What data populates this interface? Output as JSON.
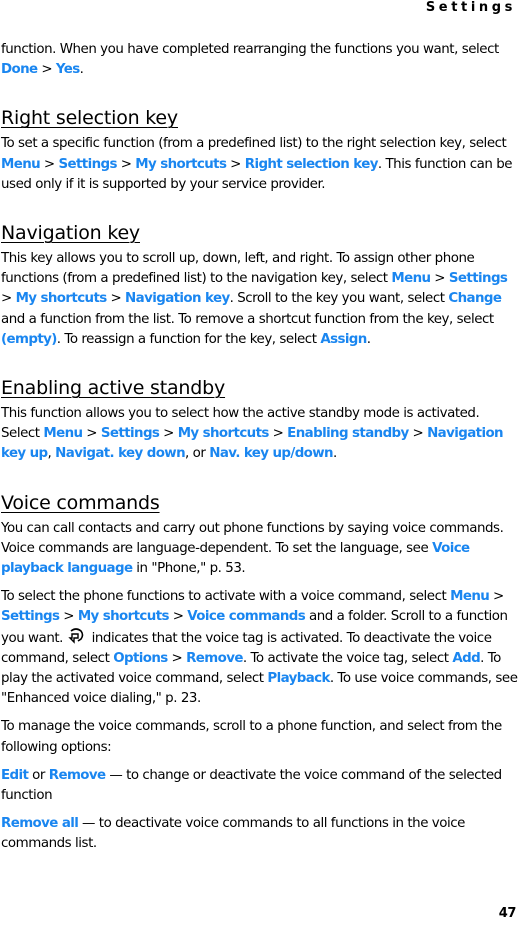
{
  "header": {
    "section": "Settings"
  },
  "footer": {
    "page_number": "47"
  },
  "intro": {
    "text1": "function. When you have completed rearranging the functions you want, select ",
    "link1": "Done",
    "sep1": " > ",
    "link2": "Yes",
    "text2": "."
  },
  "right_selection_key": {
    "title": "Right selection key",
    "t1": "To set a specific function (from a predefined list) to the right selection key, select ",
    "l1": "Menu",
    "s1": " > ",
    "l2": "Settings",
    "s2": " > ",
    "l3": "My shortcuts",
    "s3": " > ",
    "l4": "Right selection key",
    "t2": ". This function can be used only if it is supported by your service provider."
  },
  "navigation_key": {
    "title": "Navigation key",
    "t1": "This key allows you to scroll up, down, left, and right. To assign other phone functions (from a predefined list) to the navigation key, select ",
    "l1": "Menu",
    "s1": " > ",
    "l2": "Settings",
    "s2": " > ",
    "l3": "My shortcuts",
    "s3": " > ",
    "l4": "Navigation key",
    "t2": ". Scroll to the key you want, select ",
    "l5": "Change",
    "t3": " and a function from the list. To remove a shortcut function from the key, select ",
    "l6": "(empty)",
    "t4": ". To reassign a function for the key, select ",
    "l7": "Assign",
    "t5": "."
  },
  "active_standby": {
    "title": "Enabling active standby",
    "t1": "This function allows you to select how the active standby mode is activated. Select ",
    "l1": "Menu",
    "s1": " > ",
    "l2": "Settings",
    "s2": " > ",
    "l3": "My shortcuts",
    "s3": " > ",
    "l4": "Enabling standby",
    "s4": " > ",
    "l5": "Navigation key up",
    "t2": ", ",
    "l6": "Navigat. key down",
    "t3": ", or ",
    "l7": "Nav. key up/down",
    "t4": "."
  },
  "voice_commands": {
    "title": "Voice commands",
    "p1": {
      "t1": "You can call contacts and carry out phone functions by saying voice commands. Voice commands are language-dependent. To set the language, see ",
      "l1": "Voice playback language",
      "t2": " in \"Phone,\" p. 53."
    },
    "p2": {
      "t1": "To select the phone functions to activate with a voice command, select ",
      "l1": "Menu",
      "s1": " > ",
      "l2": "Settings",
      "s2": " > ",
      "l3": "My shortcuts",
      "s3": " > ",
      "l4": "Voice commands",
      "t2": " and a folder. Scroll to a function you want. ",
      "icon": "voice-tag-icon",
      "t3": " indicates that the voice tag is activated. To deactivate the voice command, select ",
      "l5": "Options",
      "s4": " > ",
      "l6": "Remove",
      "t4": ". To activate the voice tag, select ",
      "l7": "Add",
      "t5": ". To play the activated voice command, select ",
      "l8": "Playback",
      "t6": ". To use voice commands, see \"Enhanced voice dialing,\" p. 23."
    },
    "p3": {
      "text": "To manage the voice commands, scroll to a phone function, and select from the following options:"
    },
    "options": [
      {
        "l1": "Edit",
        "t1": " or ",
        "l2": "Remove",
        "t2": " — to change or deactivate the voice command of the selected function"
      },
      {
        "l1": "Remove all",
        "t1": " — to deactivate voice commands to all functions in the voice commands list."
      }
    ]
  },
  "colors": {
    "link": "#1a86f0",
    "text": "#000000"
  }
}
